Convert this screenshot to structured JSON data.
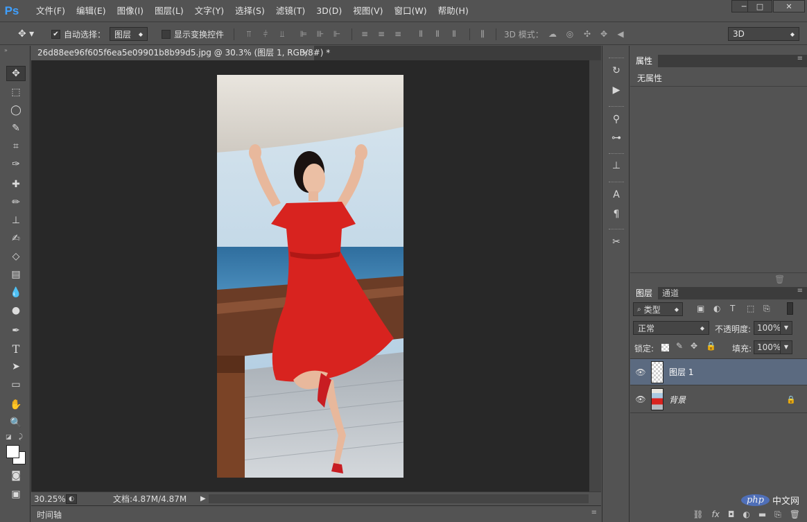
{
  "app": {
    "logo": "Ps"
  },
  "menu": [
    "文件(F)",
    "编辑(E)",
    "图像(I)",
    "图层(L)",
    "文字(Y)",
    "选择(S)",
    "滤镜(T)",
    "3D(D)",
    "视图(V)",
    "窗口(W)",
    "帮助(H)"
  ],
  "window_controls": {
    "minimize": "─",
    "maximize": "□",
    "close": "✕"
  },
  "options": {
    "auto_select_label": "自动选择：",
    "auto_select_checked": "✔",
    "auto_select_target": "图层",
    "show_transform_label": "显示变换控件",
    "mode_3d_label": "3D 模式：",
    "workspace": "3D"
  },
  "document": {
    "tab_title": "26d88ee96f605f6ea5e09901b8b99d5.jpg @ 30.3% (图层 1, RGB/8#) *",
    "tab_close": "×",
    "zoom": "30.25%",
    "doc_size": "文档:4.87M/4.87M"
  },
  "timeline": {
    "label": "时间轴"
  },
  "properties": {
    "tab": "属性",
    "content": "无属性"
  },
  "layers_panel": {
    "tabs": [
      "图层",
      "通道"
    ],
    "filter_kind": "类型",
    "blend_mode": "正常",
    "opacity_label": "不透明度:",
    "opacity_value": "100%",
    "lock_label": "锁定:",
    "fill_label": "填充:",
    "fill_value": "100%",
    "layers": [
      {
        "name": "图层 1",
        "visible_icon": "eye-icon",
        "selected": true
      },
      {
        "name": "背景",
        "visible_icon": "eye-icon",
        "locked": true
      }
    ]
  },
  "watermark": {
    "text": "php",
    "suffix": "中文网"
  },
  "colors": {
    "accent": "#3fa0ff",
    "selected_layer": "#5b6a80",
    "dress": "#d8231f"
  }
}
